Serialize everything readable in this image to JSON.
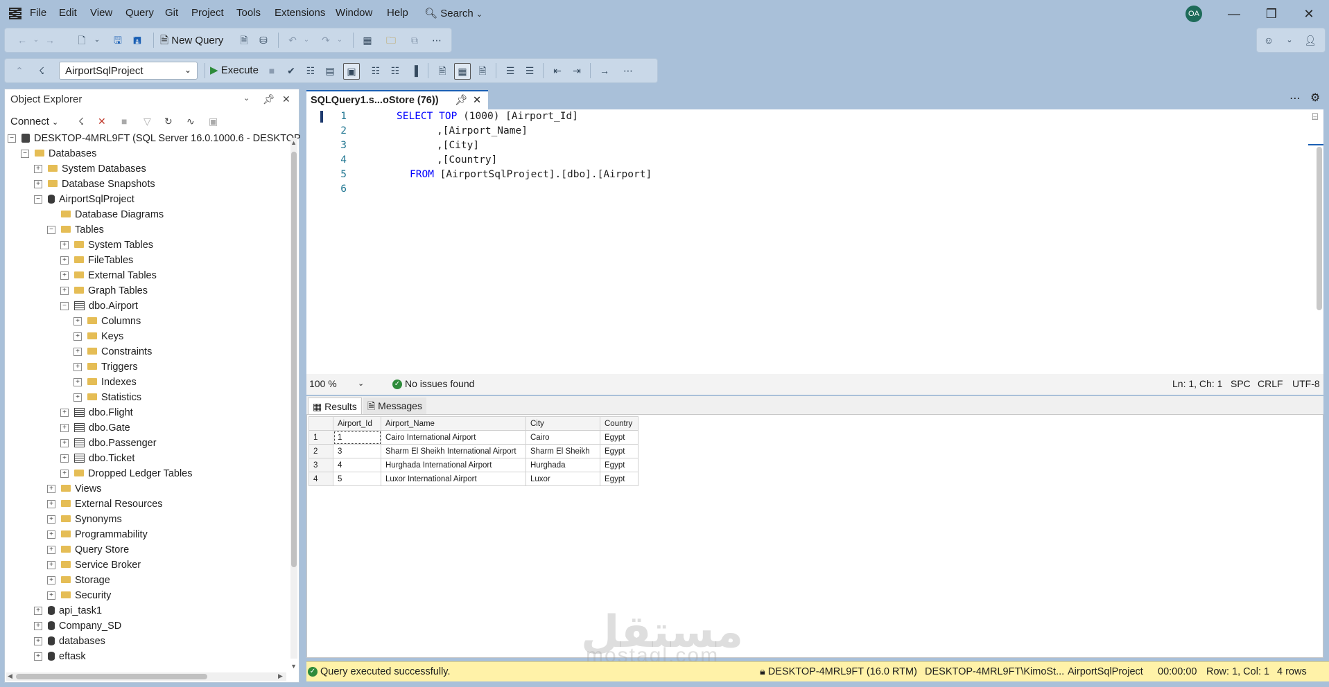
{
  "menubar": {
    "items": [
      "File",
      "Edit",
      "View",
      "Query",
      "Git",
      "Project",
      "Tools",
      "Extensions",
      "Window",
      "Help"
    ],
    "search_label": "Search",
    "avatar_initials": "OA"
  },
  "toolbar": {
    "new_query_label": "New Query",
    "database_select": "AirportSqlProject",
    "execute_label": "Execute"
  },
  "object_explorer": {
    "title": "Object Explorer",
    "connect_label": "Connect",
    "tree": [
      {
        "label": "DESKTOP-4MRL9FT (SQL Server 16.0.1000.6 - DESKTOP",
        "indent": 0,
        "exp": "−",
        "icon": "srv"
      },
      {
        "label": "Databases",
        "indent": 1,
        "exp": "−",
        "icon": "folder"
      },
      {
        "label": "System Databases",
        "indent": 2,
        "exp": "+",
        "icon": "folder"
      },
      {
        "label": "Database Snapshots",
        "indent": 2,
        "exp": "+",
        "icon": "folder"
      },
      {
        "label": "AirportSqlProject",
        "indent": 2,
        "exp": "−",
        "icon": "db"
      },
      {
        "label": "Database Diagrams",
        "indent": 3,
        "exp": "",
        "icon": "folder"
      },
      {
        "label": "Tables",
        "indent": 3,
        "exp": "−",
        "icon": "folder"
      },
      {
        "label": "System Tables",
        "indent": 4,
        "exp": "+",
        "icon": "folder"
      },
      {
        "label": "FileTables",
        "indent": 4,
        "exp": "+",
        "icon": "folder"
      },
      {
        "label": "External Tables",
        "indent": 4,
        "exp": "+",
        "icon": "folder"
      },
      {
        "label": "Graph Tables",
        "indent": 4,
        "exp": "+",
        "icon": "folder"
      },
      {
        "label": "dbo.Airport",
        "indent": 4,
        "exp": "−",
        "icon": "tbl"
      },
      {
        "label": "Columns",
        "indent": 5,
        "exp": "+",
        "icon": "folder"
      },
      {
        "label": "Keys",
        "indent": 5,
        "exp": "+",
        "icon": "folder"
      },
      {
        "label": "Constraints",
        "indent": 5,
        "exp": "+",
        "icon": "folder"
      },
      {
        "label": "Triggers",
        "indent": 5,
        "exp": "+",
        "icon": "folder"
      },
      {
        "label": "Indexes",
        "indent": 5,
        "exp": "+",
        "icon": "folder"
      },
      {
        "label": "Statistics",
        "indent": 5,
        "exp": "+",
        "icon": "folder"
      },
      {
        "label": "dbo.Flight",
        "indent": 4,
        "exp": "+",
        "icon": "tbl"
      },
      {
        "label": "dbo.Gate",
        "indent": 4,
        "exp": "+",
        "icon": "tbl"
      },
      {
        "label": "dbo.Passenger",
        "indent": 4,
        "exp": "+",
        "icon": "tbl"
      },
      {
        "label": "dbo.Ticket",
        "indent": 4,
        "exp": "+",
        "icon": "tbl"
      },
      {
        "label": "Dropped Ledger Tables",
        "indent": 4,
        "exp": "+",
        "icon": "folder"
      },
      {
        "label": "Views",
        "indent": 3,
        "exp": "+",
        "icon": "folder"
      },
      {
        "label": "External Resources",
        "indent": 3,
        "exp": "+",
        "icon": "folder"
      },
      {
        "label": "Synonyms",
        "indent": 3,
        "exp": "+",
        "icon": "folder"
      },
      {
        "label": "Programmability",
        "indent": 3,
        "exp": "+",
        "icon": "folder"
      },
      {
        "label": "Query Store",
        "indent": 3,
        "exp": "+",
        "icon": "folder"
      },
      {
        "label": "Service Broker",
        "indent": 3,
        "exp": "+",
        "icon": "folder"
      },
      {
        "label": "Storage",
        "indent": 3,
        "exp": "+",
        "icon": "folder"
      },
      {
        "label": "Security",
        "indent": 3,
        "exp": "+",
        "icon": "folder"
      },
      {
        "label": "api_task1",
        "indent": 2,
        "exp": "+",
        "icon": "db"
      },
      {
        "label": "Company_SD",
        "indent": 2,
        "exp": "+",
        "icon": "db"
      },
      {
        "label": "databases",
        "indent": 2,
        "exp": "+",
        "icon": "db"
      },
      {
        "label": "eftask",
        "indent": 2,
        "exp": "+",
        "icon": "db"
      }
    ]
  },
  "editor": {
    "tab_title": "SQLQuery1.s...oStore (76))",
    "line_numbers": [
      "1",
      "2",
      "3",
      "4",
      "5",
      "6"
    ],
    "code": {
      "l1_kw1": "SELECT",
      "l1_kw2": "TOP",
      "l1_rest": "(1000) [Airport_Id]",
      "l2": ",[Airport_Name]",
      "l3": ",[City]",
      "l4": ",[Country]",
      "l5_kw": "FROM",
      "l5_rest": "[AirportSqlProject].[dbo].[Airport]"
    },
    "zoom": "100 %",
    "issues": "No issues found",
    "position": "Ln: 1, Ch: 1",
    "whitespace": "SPC",
    "line_ending": "CRLF",
    "encoding": "UTF-8"
  },
  "results": {
    "tab_results": "Results",
    "tab_messages": "Messages",
    "columns": [
      "Airport_Id",
      "Airport_Name",
      "City",
      "Country"
    ],
    "rows": [
      {
        "n": "1",
        "cells": [
          "1",
          "Cairo International Airport",
          "Cairo",
          "Egypt"
        ]
      },
      {
        "n": "2",
        "cells": [
          "3",
          "Sharm El Sheikh International Airport",
          "Sharm El Sheikh",
          "Egypt"
        ]
      },
      {
        "n": "3",
        "cells": [
          "4",
          "Hurghada International Airport",
          "Hurghada",
          "Egypt"
        ]
      },
      {
        "n": "4",
        "cells": [
          "5",
          "Luxor International Airport",
          "Luxor",
          "Egypt"
        ]
      }
    ]
  },
  "status": {
    "message": "Query executed successfully.",
    "server": "DESKTOP-4MRL9FT (16.0 RTM)",
    "user": "DESKTOP-4MRL9FT\\KimoSt...",
    "database": "AirportSqlProject",
    "elapsed": "00:00:00",
    "rowcol": "Row: 1, Col: 1",
    "rows": "4 rows"
  },
  "watermark": {
    "arabic": "مستقل",
    "latin": "mostaql.com"
  },
  "colors": {
    "accent": "#1a5fb4",
    "keyword": "#0000ff",
    "status_bg": "#fff2a8",
    "chrome": "#a9c0d9"
  }
}
